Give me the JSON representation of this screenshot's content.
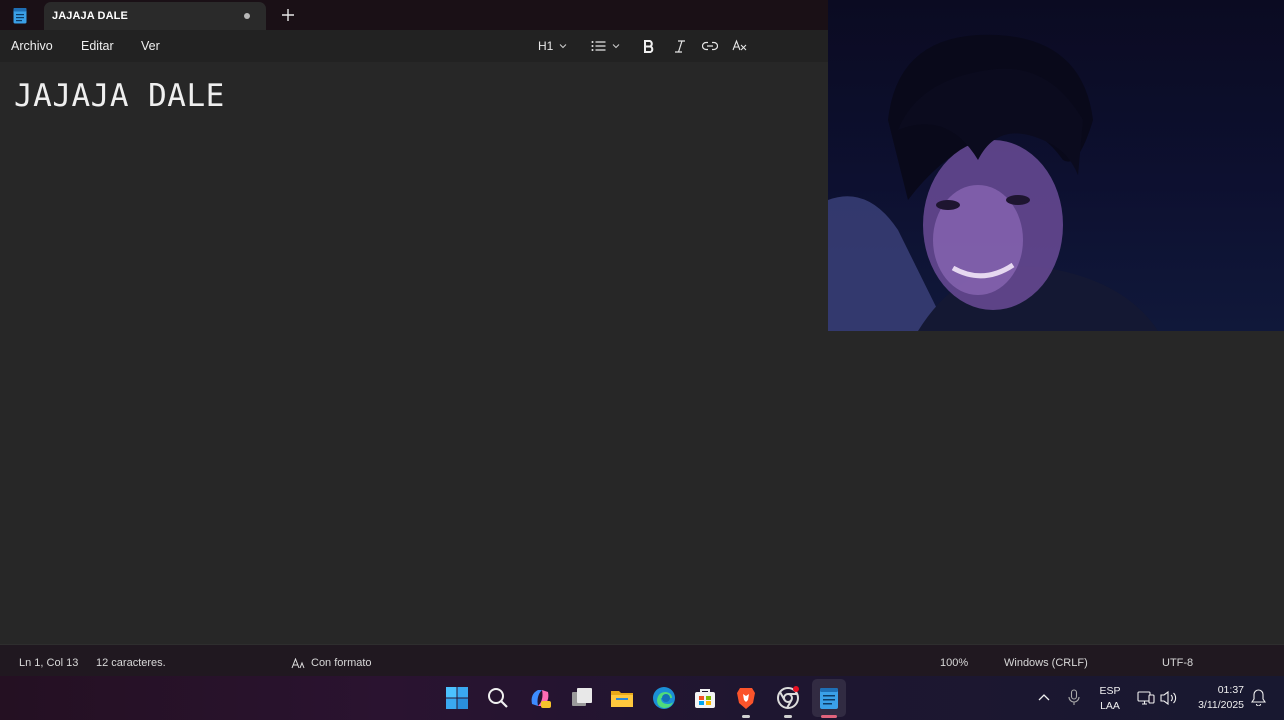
{
  "window": {
    "tab_title": "JAJAJA DALE",
    "new_tab_icon": "plus-icon"
  },
  "menu": {
    "file": "Archivo",
    "edit": "Editar",
    "view": "Ver"
  },
  "toolbar": {
    "heading": "H1",
    "list_icon": "bulleted-list-icon",
    "bold_icon": "bold-icon",
    "italic_icon": "italic-icon",
    "link_icon": "link-icon",
    "clear_format_icon": "clear-formatting-icon"
  },
  "editor": {
    "content": "JAJAJA DALE"
  },
  "statusbar": {
    "position": "Ln 1, Col 13",
    "char_count": "12 caracteres.",
    "format_mode": "Con formato",
    "zoom": "100%",
    "line_ending": "Windows (CRLF)",
    "encoding": "UTF-8"
  },
  "taskbar": {
    "apps": [
      "start-icon",
      "search-icon",
      "copilot-icon",
      "task-view-icon",
      "file-explorer-icon",
      "edge-icon",
      "store-icon",
      "brave-icon",
      "chrome-icon",
      "notepad-icon"
    ],
    "language_line1": "ESP",
    "language_line2": "LAA",
    "time": "01:37",
    "date": "3/11/2025"
  },
  "colors": {
    "background": "#272727",
    "accent": "#e0637c",
    "notepad_blue": "#3aa0e8"
  }
}
